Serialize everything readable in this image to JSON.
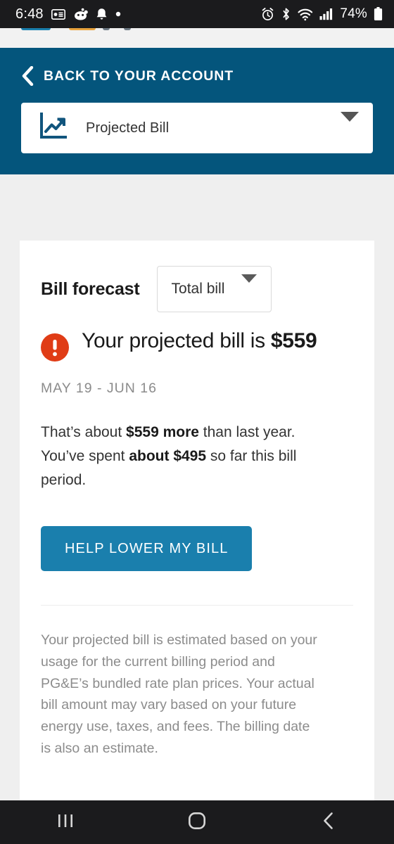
{
  "status_bar": {
    "time": "6:48",
    "battery": "74%",
    "left_icons": [
      "news-card-icon",
      "reddit-icon",
      "bell-icon",
      "dot-icon"
    ],
    "right_icons": [
      "alarm-icon",
      "bluetooth-icon",
      "wifi-icon",
      "signal-icon",
      "battery-icon"
    ]
  },
  "header": {
    "back_label": "BACK TO YOUR ACCOUNT",
    "back_icon": "chevron-left-icon",
    "selector": {
      "icon": "line-chart-trend-icon",
      "value": "Projected Bill",
      "caret_icon": "chevron-down-icon"
    },
    "background_color": "#04557c"
  },
  "card": {
    "title": "Bill forecast",
    "view_selector": {
      "value": "Total bill",
      "caret_icon": "chevron-down-icon"
    },
    "alert_icon": "alert-exclamation-icon",
    "alert_color": "#e03c16",
    "headline_prefix": "Your projected bill is ",
    "headline_amount": "$559",
    "date_range": "MAY 19 - JUN 16",
    "summary": {
      "part1": "That’s about ",
      "bold1": "$559 more",
      "part2": " than last year. You’ve spent ",
      "bold2": "about $495",
      "part3": " so far this bill period."
    },
    "cta_label": "HELP LOWER MY BILL",
    "cta_color": "#1a7fad",
    "disclaimer": "Your projected bill is estimated based on your usage for the current billing period and PG&E’s bundled rate plan prices. Your actual bill amount may vary based on your future energy use, taxes, and fees. The billing date is also an estimate."
  },
  "nav_bar": {
    "recents_icon": "recents-icon",
    "home_icon": "home-icon",
    "back_icon": "back-icon"
  }
}
